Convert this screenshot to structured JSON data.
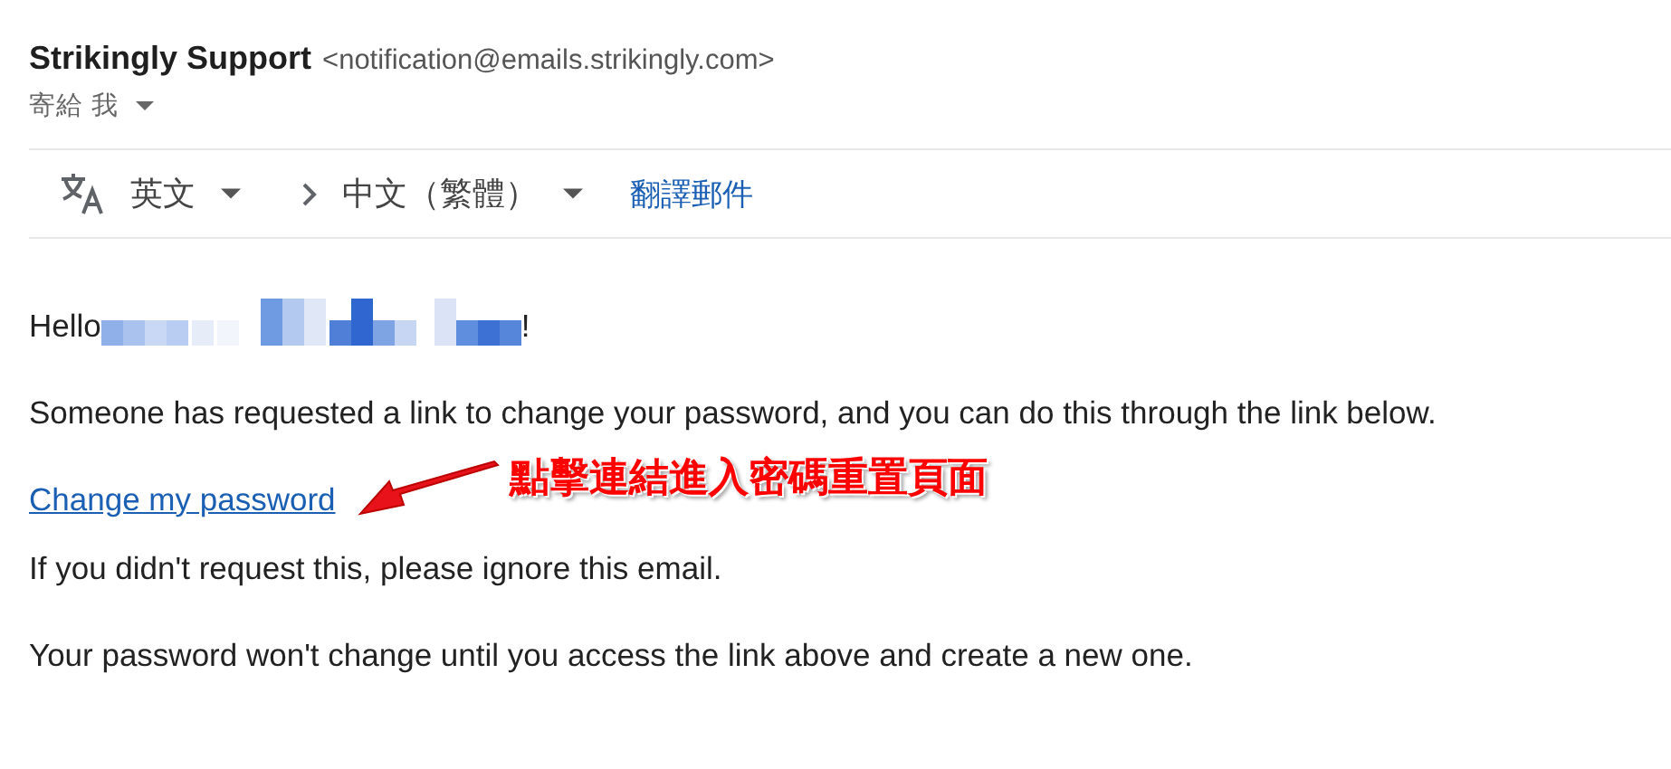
{
  "sender": {
    "name": "Strikingly Support",
    "email": "<notification@emails.strikingly.com>"
  },
  "recipient": {
    "label": "寄給 我"
  },
  "translate_bar": {
    "source_language": "英文",
    "target_language": "中文（繁體）",
    "translate_link": "翻譯郵件"
  },
  "body": {
    "greeting": "Hello",
    "greeting_end": "!",
    "paragraph_1": "Someone has requested a link to change your password, and you can do this through the link below.",
    "link": "Change my password",
    "paragraph_2": "If you didn't request this, please ignore this email.",
    "paragraph_3": "Your password won't change until you access the link above and create a new one."
  },
  "annotation": {
    "text": "點擊連結進入密碼重置頁面"
  }
}
